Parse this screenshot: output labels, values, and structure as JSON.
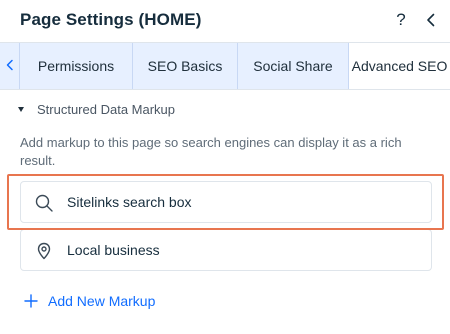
{
  "header": {
    "title": "Page Settings (HOME)",
    "help_label": "?"
  },
  "tabs": [
    {
      "label": "Permissions",
      "active": false
    },
    {
      "label": "SEO Basics",
      "active": false
    },
    {
      "label": "Social Share",
      "active": false
    },
    {
      "label": "Advanced SEO",
      "active": true
    }
  ],
  "section": {
    "label": "Structured Data Markup",
    "expanded": true
  },
  "description": "Add markup to this page so search engines can display it as a rich result.",
  "markups": [
    {
      "label": "Sitelinks search box",
      "icon": "search-icon",
      "highlighted": true
    },
    {
      "label": "Local business",
      "icon": "location-pin-icon",
      "highlighted": false
    }
  ],
  "add_button": {
    "label": "Add New Markup",
    "icon": "plus-icon"
  },
  "colors": {
    "accent": "#116dff",
    "highlight": "#e8754f",
    "tab_bar": "#e7f0ff"
  }
}
